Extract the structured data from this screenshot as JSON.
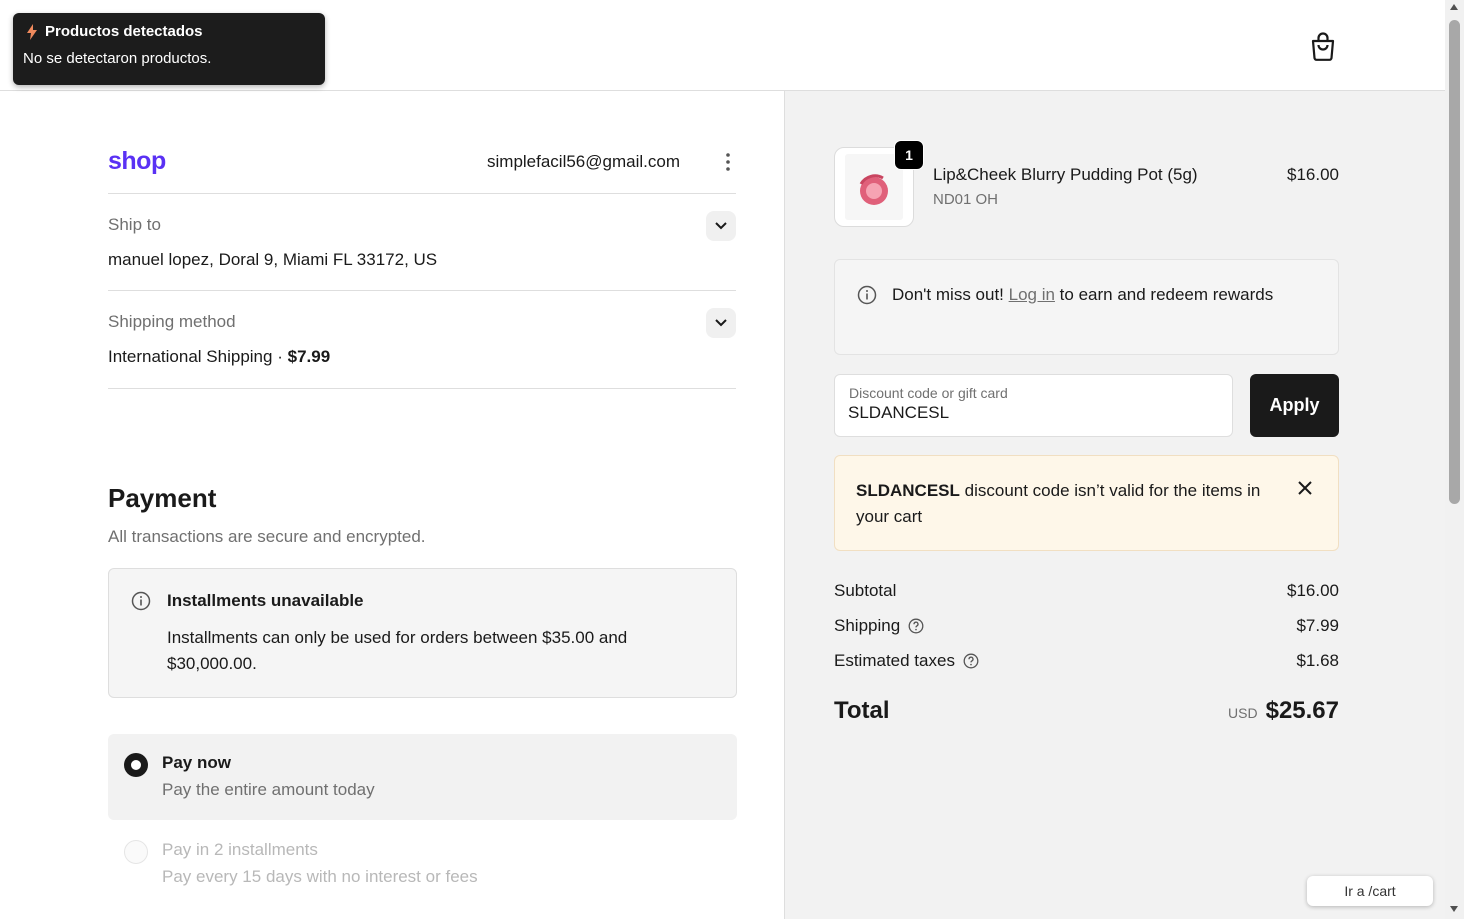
{
  "toast": {
    "title": "Productos detectados",
    "message": "No se detectaron productos."
  },
  "header": {
    "cart_icon": "shopping-bag-icon"
  },
  "account": {
    "logo_text": "shop",
    "email": "simplefacil56@gmail.com"
  },
  "ship_to": {
    "label": "Ship to",
    "value": "manuel lopez, Doral 9, Miami FL 33172, US"
  },
  "shipping_method": {
    "label": "Shipping method",
    "name": "International Shipping",
    "separator": "·",
    "price": "$7.99"
  },
  "payment": {
    "title": "Payment",
    "subtitle": "All transactions are secure and encrypted.",
    "installments_notice": {
      "title": "Installments unavailable",
      "text": "Installments can only be used for orders between $35.00 and $30,000.00."
    },
    "options": [
      {
        "title": "Pay now",
        "subtitle": "Pay the entire amount today",
        "selected": true
      },
      {
        "title": "Pay in 2 installments",
        "subtitle": "Pay every 15 days with no interest or fees",
        "selected": false
      }
    ]
  },
  "order": {
    "item": {
      "quantity": "1",
      "name": "Lip&Cheek Blurry Pudding Pot (5g)",
      "variant": "ND01 OH",
      "price": "$16.00"
    },
    "rewards": {
      "prefix": "Don't miss out! ",
      "link": "Log in",
      "suffix": " to earn and redeem rewards"
    },
    "discount": {
      "placeholder": "Discount code or gift card",
      "value": "SLDANCESL",
      "apply_label": "Apply"
    },
    "discount_error": {
      "code": "SLDANCESL",
      "message": " discount code isn’t valid for the items in your cart"
    },
    "summary": {
      "subtotal_label": "Subtotal",
      "subtotal": "$16.00",
      "shipping_label": "Shipping",
      "shipping": "$7.99",
      "taxes_label": "Estimated taxes",
      "taxes": "$1.68",
      "total_label": "Total",
      "currency": "USD",
      "total": "$25.67"
    }
  },
  "goto_cart": "Ir a /cart",
  "colors": {
    "shop_brand": "#5a31f4",
    "dark": "#1a1a1a",
    "alert_bg": "#fef7e9"
  }
}
